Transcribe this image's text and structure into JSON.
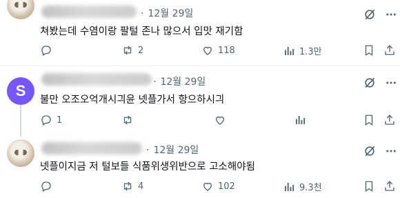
{
  "replies": [
    {
      "date": "12월 29일",
      "text": "쳐봤는데 수염이랑 팔털 존나 많으서 입맛 재기함",
      "replies_count": "",
      "reposts": "2",
      "likes": "118",
      "views": "1.3만"
    },
    {
      "date": "12월 29일",
      "avatar_letter": "S",
      "text": "불만 오조오억개시긔윤 넷플가서 항으하시긔",
      "replies_count": "1",
      "reposts": "",
      "likes": "",
      "views": ""
    },
    {
      "date": "12월 29일",
      "text": "넷플이지금 저 털보들 식품위생위반으로 고소해야됨",
      "replies_count": "",
      "reposts": "4",
      "likes": "102",
      "views": "9.3천"
    }
  ],
  "icons": {
    "reply": "reply-icon",
    "repost": "repost-icon",
    "like": "heart-icon",
    "views": "views-icon",
    "bookmark": "bookmark-icon",
    "share": "share-icon",
    "grok": "grok-icon",
    "more": "more-icon"
  },
  "colors": {
    "text": "#0f1419",
    "muted": "#536471",
    "avatar_purple": "#7856ff"
  }
}
